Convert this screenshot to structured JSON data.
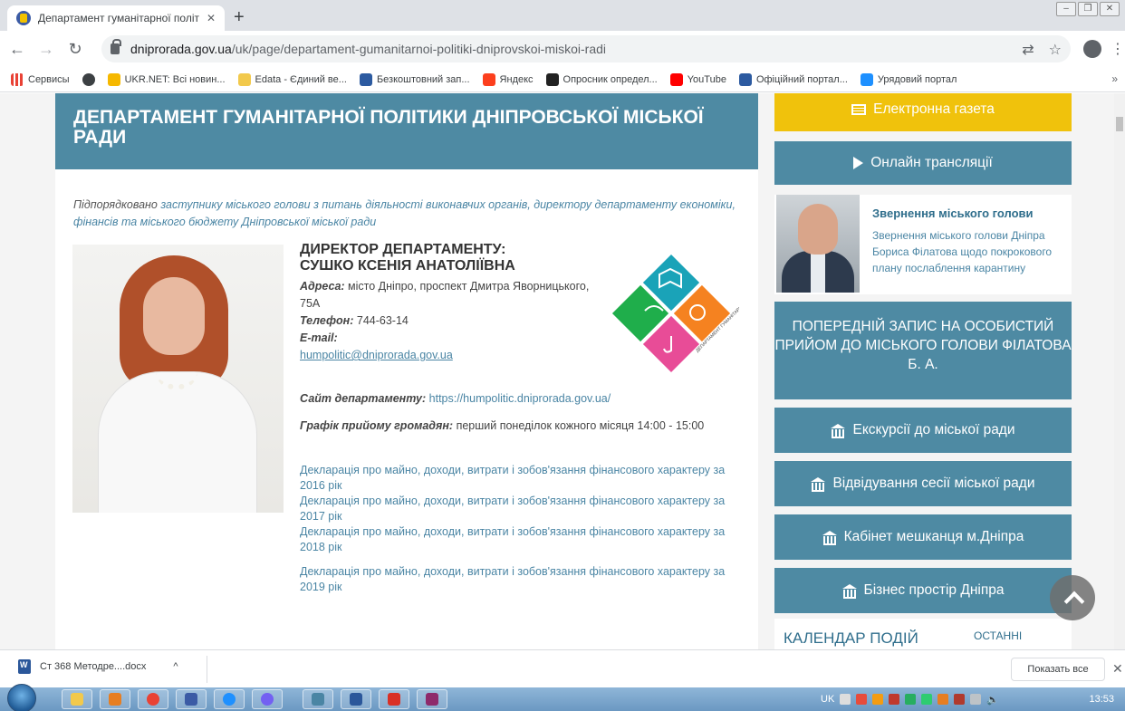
{
  "browser": {
    "tab_title": "Департамент гуманітарної політ",
    "new_tab": "+",
    "url_host": "dniprorada.gov.ua",
    "url_path": "/uk/page/departament-gumanitarnoi-politiki-dniprovskoi-miskoi-radi",
    "bookmarks": [
      {
        "label": "Сервисы",
        "color": "#e94235"
      },
      {
        "label": "",
        "color": "#3c4043"
      },
      {
        "label": "UKR.NET: Всі новин...",
        "color": "#f6b800"
      },
      {
        "label": "Edata - Єдиний ве...",
        "color": "#f2c94c"
      },
      {
        "label": "Безкоштовний зап...",
        "color": "#2c5aa0"
      },
      {
        "label": "Яндекс",
        "color": "#fc3f1d"
      },
      {
        "label": "Опросник определ...",
        "color": "#222222"
      },
      {
        "label": "YouTube",
        "color": "#ff0000"
      },
      {
        "label": "Офіційний портал...",
        "color": "#2c5aa0"
      },
      {
        "label": "Урядовий портал",
        "color": "#1e90ff"
      }
    ],
    "bookmarks_more": "»"
  },
  "page": {
    "title": "ДЕПАРТАМЕНТ ГУМАНІТАРНОЇ ПОЛІТИКИ ДНІПРОВСЬКОЇ МІСЬКОЇ РАДИ",
    "subordinate_lead": "Підпорядковано",
    "subordinate_link": "заступнику міського голови з питань діяльності виконавчих органів, директору департаменту економіки, фінансів та міського бюджету Дніпровської міської ради",
    "director_heading": "ДИРЕКТОР ДЕПАРТАМЕНТУ:",
    "director_name": "СУШКО КСЕНІЯ АНАТОЛІЇВНА",
    "address_label": "Адреса:",
    "address_value": "місто Дніпро, проспект Дмитра Яворницького, 75А",
    "phone_label": "Телефон:",
    "phone_value": "744-63-14",
    "email_label": "E-mail:",
    "email_value": "humpolitic@dniprorada.gov.ua",
    "site_label": "Сайт департаменту:",
    "site_value": "https://humpolitic.dniprorada.gov.ua/",
    "schedule_label": "Графік прийому громадян:",
    "schedule_value": "перший понеділок кожного місяця 14:00 - 15:00",
    "declarations": [
      "Декларація про майно, доходи, витрати і зобов'язання фінансового характеру за 2016 рік",
      "Декларація про майно, доходи, витрати і зобов'язання фінансового характеру за 2017 рік",
      "Декларація про майно, доходи, витрати і зобов'язання фінансового характеру за 2018 рік",
      "Декларація про майно, доходи, витрати і зобов'язання фінансового характеру за 2019 рік"
    ],
    "logo_text": "ДЕПАРТАМЕНТ ГУМАНІТАРНОЇ ПОЛІТИКИ ДНІПРОВСЬКОЇ МІСЬКОЇ РАДИ",
    "logo_colors": [
      "#1aa3b8",
      "#1fae4b",
      "#f58220",
      "#e84c97"
    ]
  },
  "sidebar": {
    "newspaper": "Електронна газета",
    "broadcasts": "Онлайн трансляції",
    "mayor_title": "Звернення міського голови",
    "mayor_text": "Звернення міського голови Дніпра Бориса Філатова щодо покрокового плану послаблення карантину",
    "appointment": "ПОПЕРЕДНІЙ ЗАПИС НА ОСОБИСТИЙ ПРИЙОМ ДО МІСЬКОГО ГОЛОВИ ФІЛАТОВА Б. А.",
    "excursions": "Екскурсії до міської ради",
    "session": "Відвідування сесії міської ради",
    "cabinet": "Кабінет мешканця м.Дніпра",
    "business": "Бізнес простір Дніпра",
    "calendar": "КАЛЕНДАР ПОДІЙ",
    "recent": "ОСТАННІ"
  },
  "download_bar": {
    "file_name": "Ст 368 Методре....docx",
    "show_all": "Показать все"
  },
  "taskbar": {
    "lang": "UK",
    "time": "13:53"
  },
  "colors": {
    "accent": "#4e8aa3",
    "yellow": "#f0c20c",
    "link": "#4a85a4"
  }
}
